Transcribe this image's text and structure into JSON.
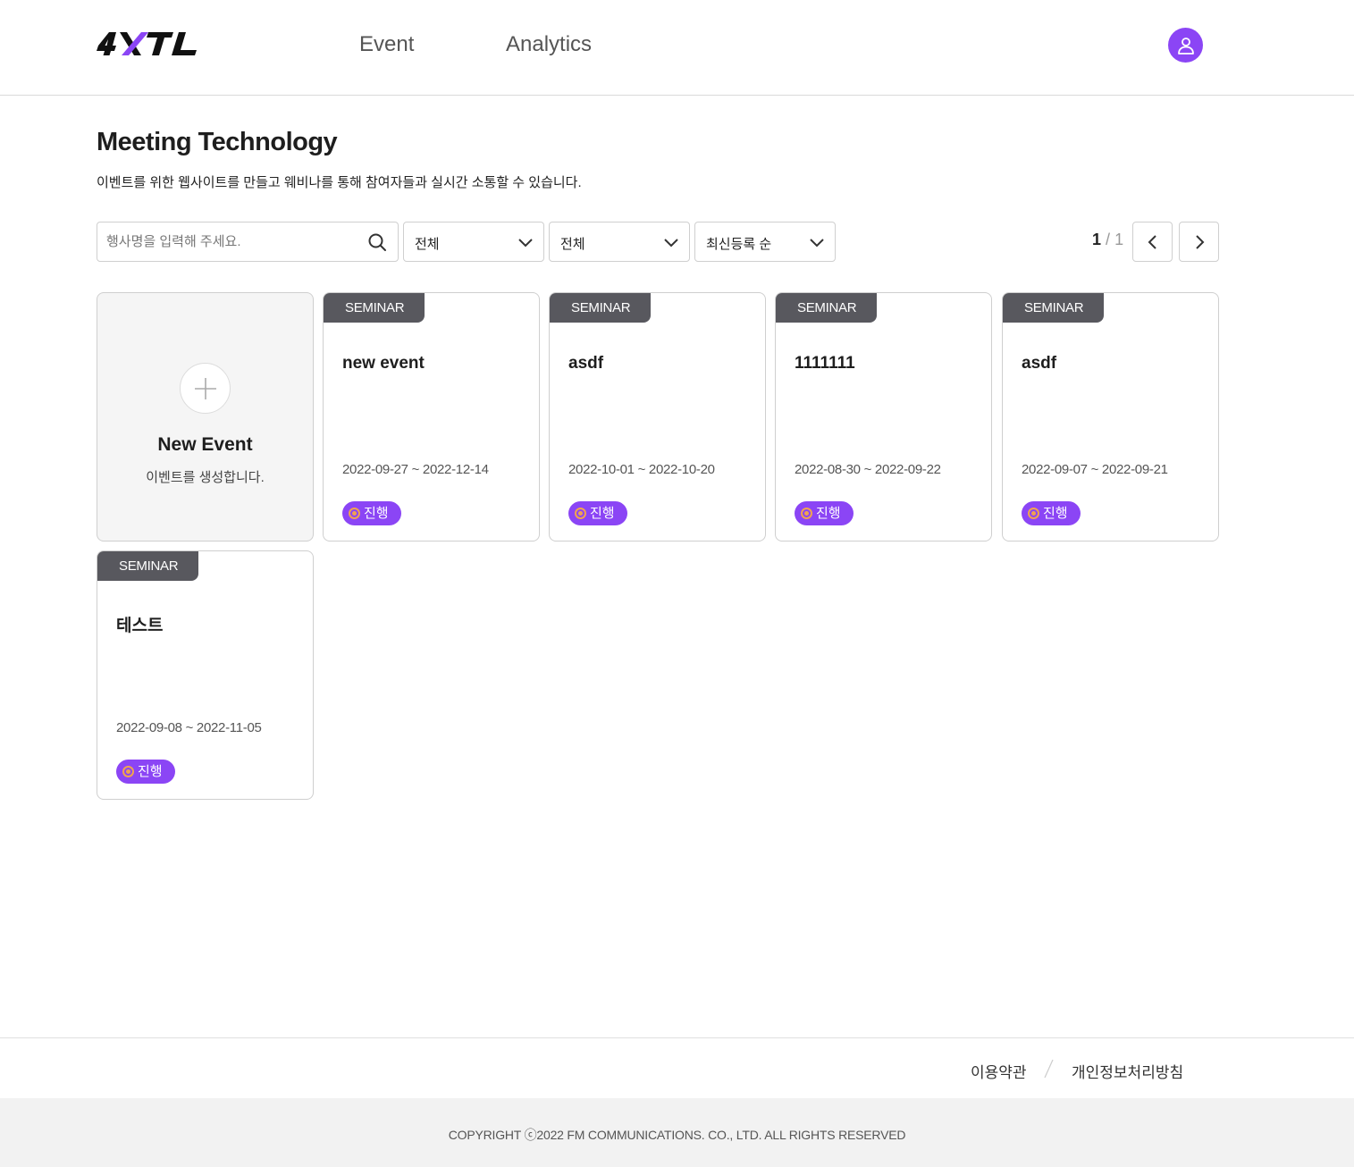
{
  "header": {
    "logo": "4XTL",
    "nav": [
      {
        "label": "Event"
      },
      {
        "label": "Analytics"
      }
    ],
    "avatar_icon": "user-icon"
  },
  "page": {
    "title": "Meeting Technology",
    "description": "이벤트를 위한 웹사이트를 만들고 웨비나를 통해 참여자들과 실시간 소통할 수 있습니다."
  },
  "toolbar": {
    "search_placeholder": "행사명을 입력해 주세요.",
    "search_value": "",
    "filter1": "전체",
    "filter2": "전체",
    "sort": "최신등록 순",
    "page_current": "1",
    "page_sep": "/",
    "page_total": "1"
  },
  "new_event": {
    "title": "New Event",
    "subtitle": "이벤트를 생성합니다."
  },
  "events": [
    {
      "tag": "SEMINAR",
      "title": "new event",
      "date": "2022-09-27 ~ 2022-12-14",
      "status": "진행"
    },
    {
      "tag": "SEMINAR",
      "title": "asdf",
      "date": "2022-10-01 ~ 2022-10-20",
      "status": "진행"
    },
    {
      "tag": "SEMINAR",
      "title": "1111111",
      "date": "2022-08-30 ~ 2022-09-22",
      "status": "진행"
    },
    {
      "tag": "SEMINAR",
      "title": "asdf",
      "date": "2022-09-07 ~ 2022-09-21",
      "status": "진행"
    },
    {
      "tag": "SEMINAR",
      "title": "테스트",
      "date": "2022-09-08 ~ 2022-11-05",
      "status": "진행"
    }
  ],
  "footer": {
    "terms": "이용약관",
    "privacy": "개인정보처리방침",
    "copyright": "COPYRIGHT ⓒ2022  FM COMMUNICATIONS. CO., LTD. ALL RIGHTS RESERVED"
  },
  "colors": {
    "accent": "#8b45f5",
    "tag_bg": "#58585e",
    "status_dot": "#f0a350"
  }
}
